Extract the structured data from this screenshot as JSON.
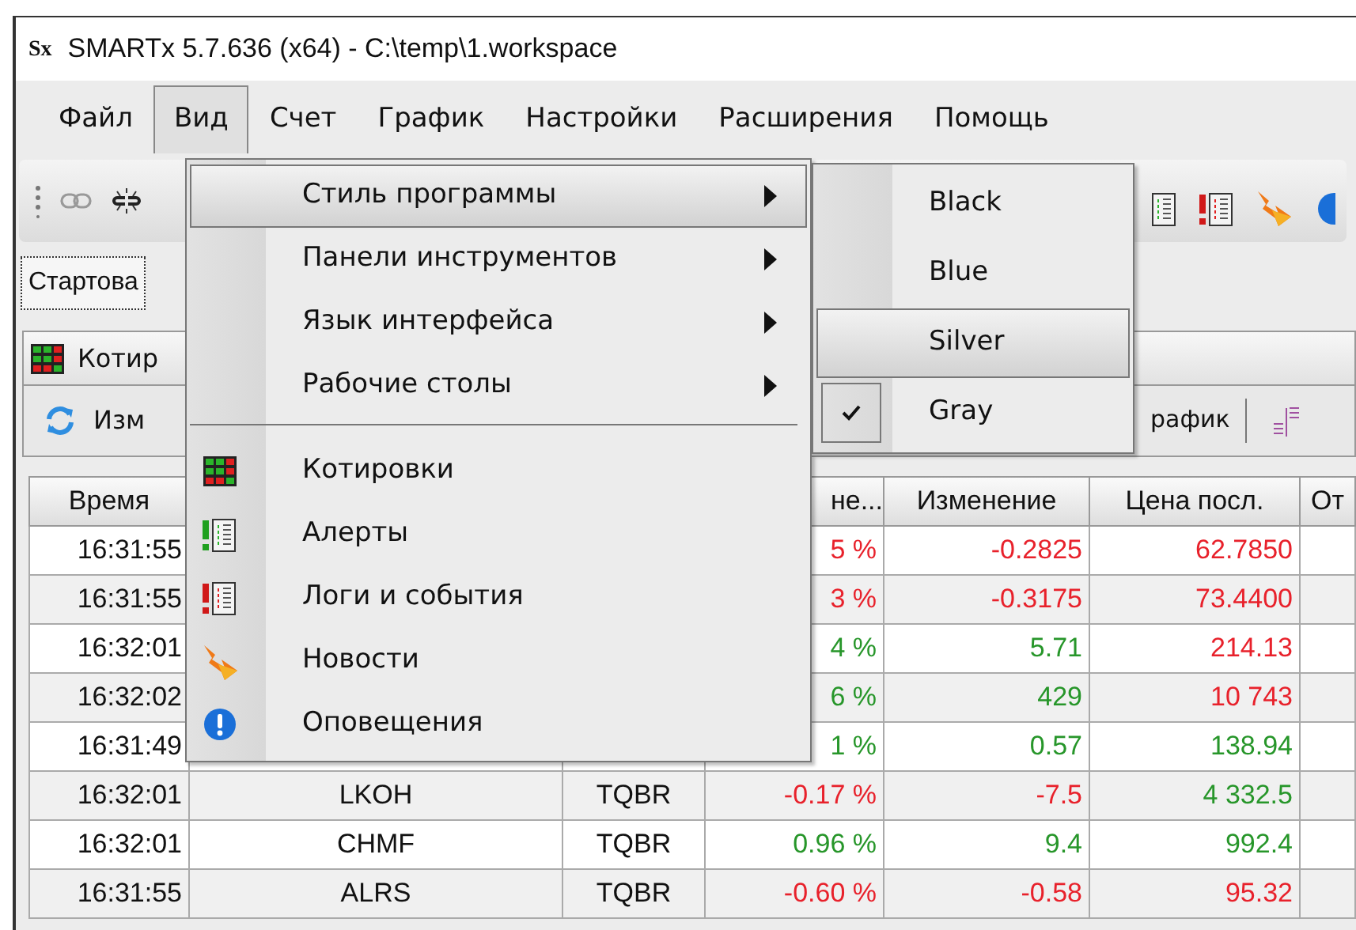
{
  "window": {
    "logo": "Sx",
    "title": "SMARTx 5.7.636 (x64) - C:\\temp\\1.workspace"
  },
  "menubar": [
    {
      "label": "Файл",
      "selected": false
    },
    {
      "label": "Вид",
      "selected": true
    },
    {
      "label": "Счет",
      "selected": false
    },
    {
      "label": "График",
      "selected": false
    },
    {
      "label": "Настройки",
      "selected": false
    },
    {
      "label": "Расширения",
      "selected": false
    },
    {
      "label": "Помощь",
      "selected": false
    }
  ],
  "tab": {
    "label": "Стартова"
  },
  "panel": {
    "title": "Котир",
    "toolbar_button": "Изм",
    "chart_button": "рафик"
  },
  "table": {
    "columns": [
      "Время",
      "",
      "",
      "не...",
      "Изменение",
      "Цена посл.",
      "От"
    ],
    "rows": [
      {
        "time": "16:31:55",
        "ticker": "",
        "board": "",
        "pct": "5 %",
        "change": "-0.2825",
        "price": "62.7850",
        "change_up": false,
        "price_up": false
      },
      {
        "time": "16:31:55",
        "ticker": "",
        "board": "",
        "pct": "3 %",
        "change": "-0.3175",
        "price": "73.4400",
        "change_up": false,
        "price_up": false
      },
      {
        "time": "16:32:01",
        "ticker": "",
        "board": "",
        "pct": "4 %",
        "change": "5.71",
        "price": "214.13",
        "change_up": true,
        "price_up": false
      },
      {
        "time": "16:32:02",
        "ticker": "",
        "board": "",
        "pct": "6 %",
        "change": "429",
        "price": "10 743",
        "change_up": true,
        "price_up": false
      },
      {
        "time": "16:31:49",
        "ticker": "",
        "board": "",
        "pct": "1 %",
        "change": "0.57",
        "price": "138.94",
        "change_up": true,
        "price_up": true
      },
      {
        "time": "16:32:01",
        "ticker": "LKOH",
        "board": "TQBR",
        "pct": "-0.17 %",
        "change": "-7.5",
        "price": "4 332.5",
        "change_up": false,
        "price_up": true
      },
      {
        "time": "16:32:01",
        "ticker": "CHMF",
        "board": "TQBR",
        "pct": "0.96 %",
        "change": "9.4",
        "price": "992.4",
        "change_up": true,
        "price_up": true
      },
      {
        "time": "16:31:55",
        "ticker": "ALRS",
        "board": "TQBR",
        "pct": "-0.60 %",
        "change": "-0.58",
        "price": "95.32",
        "change_up": false,
        "price_up": false
      }
    ]
  },
  "view_menu": {
    "items": [
      {
        "kind": "submenu",
        "label": "Стиль программы",
        "selected": true
      },
      {
        "kind": "submenu",
        "label": "Панели инструментов",
        "selected": false
      },
      {
        "kind": "submenu",
        "label": "Язык интерфейса",
        "selected": false
      },
      {
        "kind": "submenu",
        "label": "Рабочие столы",
        "selected": false
      },
      {
        "kind": "separator"
      },
      {
        "kind": "command",
        "label": "Котировки",
        "selected": false
      },
      {
        "kind": "command",
        "label": "Алерты",
        "selected": false
      },
      {
        "kind": "command",
        "label": "Логи и события",
        "selected": false
      },
      {
        "kind": "command",
        "label": "Новости",
        "selected": false
      },
      {
        "kind": "command",
        "label": "Оповещения",
        "selected": false
      }
    ]
  },
  "style_submenu": {
    "items": [
      {
        "label": "Black",
        "selected": false,
        "checked": false
      },
      {
        "label": "Blue",
        "selected": false,
        "checked": false
      },
      {
        "label": "Silver",
        "selected": true,
        "checked": false
      },
      {
        "label": "Gray",
        "selected": false,
        "checked": true
      }
    ]
  }
}
